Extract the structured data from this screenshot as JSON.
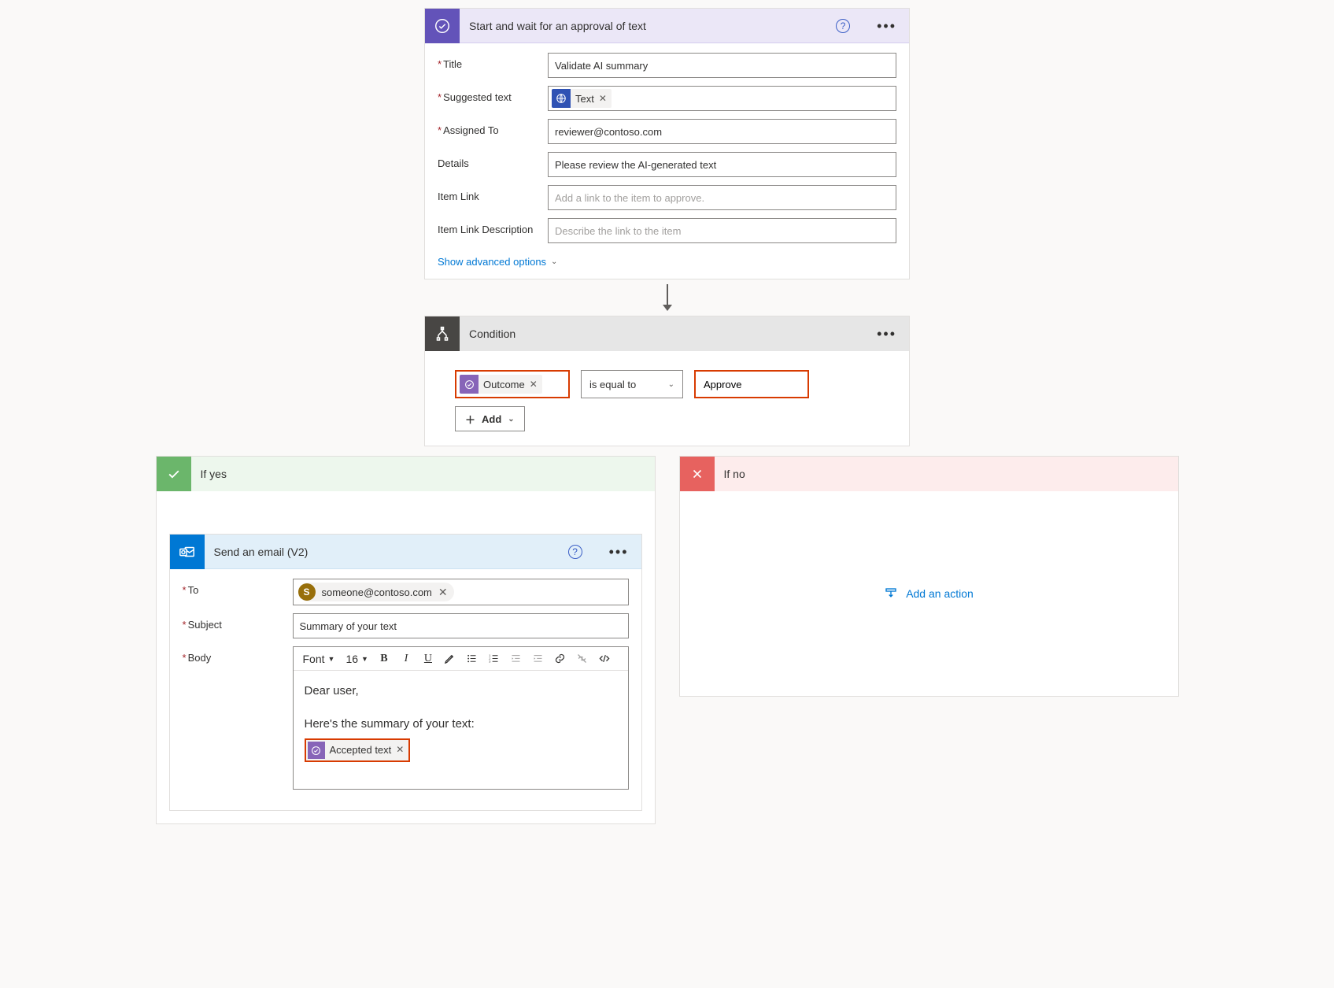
{
  "approval": {
    "title": "Start and wait for an approval of text",
    "fields": {
      "title_label": "Title",
      "title_value": "Validate AI summary",
      "suggested_label": "Suggested text",
      "suggested_token": "Text",
      "assigned_label": "Assigned To",
      "assigned_value": "reviewer@contoso.com",
      "details_label": "Details",
      "details_value": "Please review the AI-generated text",
      "item_link_label": "Item Link",
      "item_link_placeholder": "Add a link to the item to approve.",
      "item_link_desc_label": "Item Link Description",
      "item_link_desc_placeholder": "Describe the link to the item"
    },
    "advanced_link": "Show advanced options"
  },
  "condition": {
    "title": "Condition",
    "left_token": "Outcome",
    "operator": "is equal to",
    "right_value": "Approve",
    "add_label": "Add"
  },
  "branches": {
    "yes_label": "If yes",
    "no_label": "If no",
    "add_action": "Add an action"
  },
  "email": {
    "title": "Send an email (V2)",
    "to_label": "To",
    "to_recipient": "someone@contoso.com",
    "to_avatar_initial": "S",
    "subject_label": "Subject",
    "subject_value": "Summary of your text",
    "body_label": "Body",
    "rte": {
      "font_label": "Font",
      "size_label": "16"
    },
    "body_line1": "Dear user,",
    "body_line2": "Here's the summary of your text:",
    "body_token": "Accepted text"
  }
}
